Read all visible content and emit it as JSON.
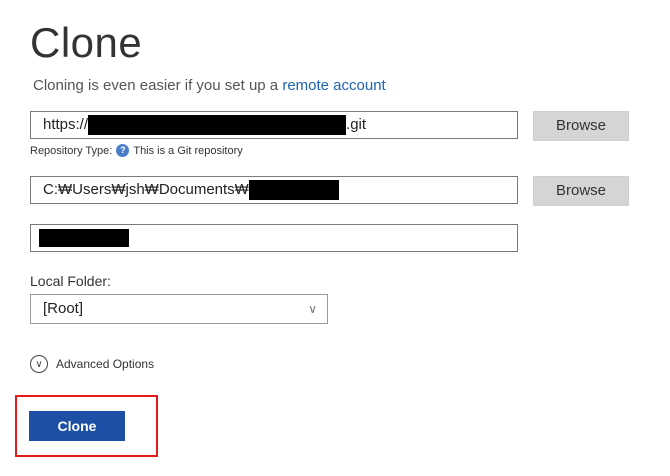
{
  "header": {
    "title": "Clone",
    "subtitle_text": "Cloning is even easier if you set up a",
    "subtitle_link": "remote account"
  },
  "repo": {
    "url_prefix": "https://",
    "url_suffix": ".git",
    "browse_label": "Browse",
    "type_label": "Repository Type:",
    "type_value": "This is a Git repository"
  },
  "destination": {
    "path_prefix": "C:₩Users₩jsh₩Documents₩",
    "browse_label": "Browse"
  },
  "local_folder": {
    "label": "Local Folder:",
    "selected": "[Root]"
  },
  "advanced": {
    "label": "Advanced Options"
  },
  "actions": {
    "clone_label": "Clone"
  },
  "colors": {
    "primary": "#1d4fa5",
    "link": "#1d62b3",
    "highlight": "#e31b1b"
  }
}
